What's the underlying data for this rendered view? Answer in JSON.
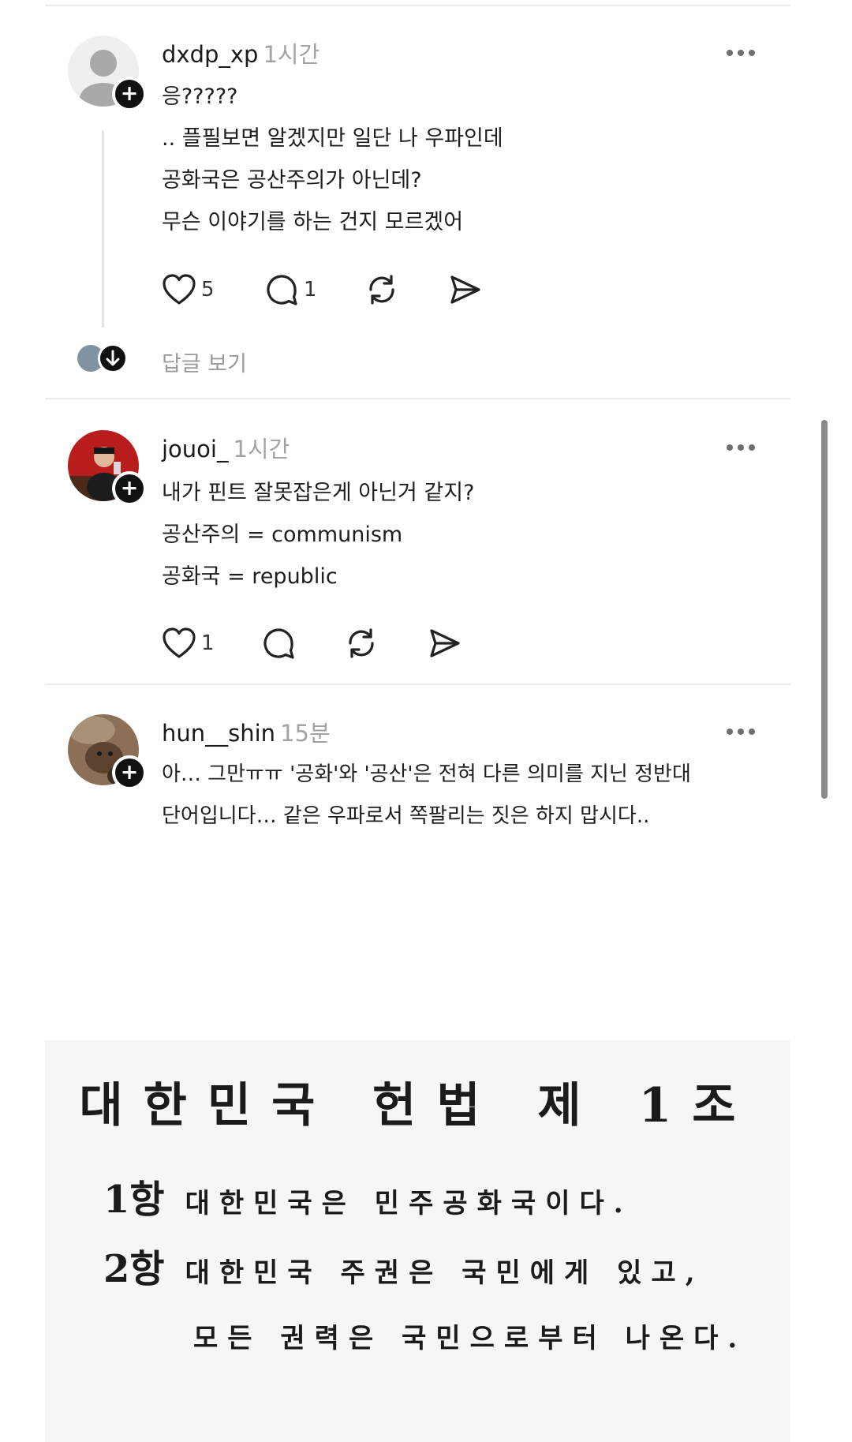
{
  "comments": [
    {
      "username": "dxdp_xp",
      "time": "1시간",
      "lines": [
        "응?????",
        ".. 플필보면 알겠지만 일단 나 우파인데",
        "공화국은 공산주의가 아닌데?",
        "무슨 이야기를 하는 건지 모르겠어"
      ],
      "likes": "5",
      "comments_count": "1",
      "replies_label": "답글 보기"
    },
    {
      "username": "jouoi_",
      "time": "1시간",
      "lines": [
        "내가 핀트 잘못잡은게 아닌거 같지?",
        "공산주의 = communism",
        "공화국 = republic"
      ],
      "likes": "1",
      "comments_count": ""
    },
    {
      "username": "hun__shin",
      "time": "15분",
      "lines": [
        "아… 그만ㅠㅠ '공화'와 '공산'은 전혀 다른 의미를 지닌 정반대",
        "단어입니다… 같은 우파로서 쪽팔리는 짓은 하지 맙시다.."
      ]
    }
  ],
  "icons": {
    "follow": "plus-icon",
    "like": "heart-icon",
    "comment": "comment-bubble-icon",
    "repost": "repost-icon",
    "share": "send-icon",
    "more": "more-dots-icon",
    "expand": "arrow-down-icon"
  },
  "document": {
    "title": "대한민국 헌법 제 1조",
    "clause1": {
      "num": "1항",
      "text": "대한민국은 민주공화국이다."
    },
    "clause2": {
      "num": "2항",
      "text": "대한민국 주권은 국민에게 있고,",
      "text2": "모든 권력은 국민으로부터 나온다."
    }
  }
}
